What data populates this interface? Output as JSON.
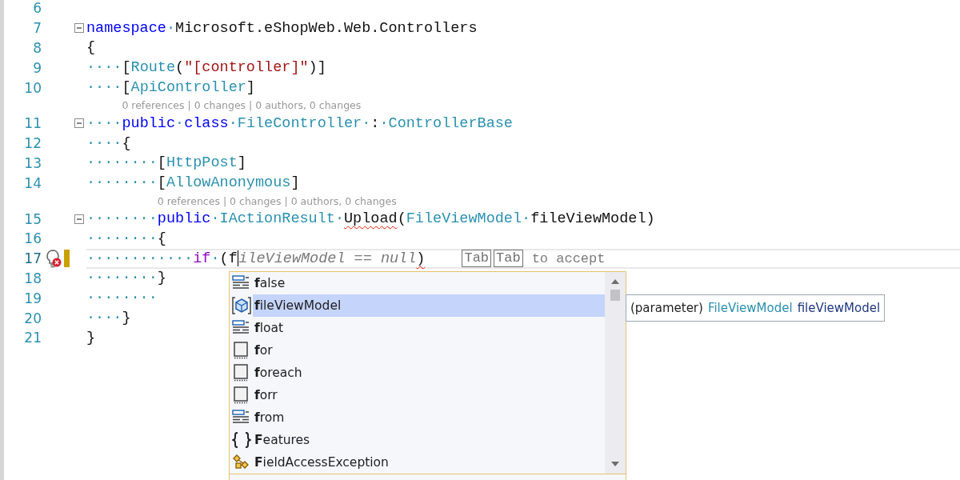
{
  "editor": {
    "lines": [
      {
        "number": "6",
        "fold": false,
        "current": false,
        "changed": false
      },
      {
        "number": "7",
        "fold": true,
        "current": false,
        "changed": false,
        "tokens": [
          {
            "text": "namespace",
            "kind": "keyword"
          },
          {
            "text": "·",
            "kind": "ws"
          },
          {
            "text": "Microsoft.eShopWeb.Web.Controllers",
            "kind": "plain"
          }
        ]
      },
      {
        "number": "8",
        "fold": false,
        "current": false,
        "changed": false,
        "tokens": [
          {
            "text": "{",
            "kind": "plain"
          }
        ]
      },
      {
        "number": "9",
        "fold": false,
        "current": false,
        "changed": false,
        "tokens": [
          {
            "text": "····",
            "kind": "ws"
          },
          {
            "text": "[",
            "kind": "plain"
          },
          {
            "text": "Route",
            "kind": "type"
          },
          {
            "text": "(",
            "kind": "plain"
          },
          {
            "text": "\"[controller]\"",
            "kind": "string"
          },
          {
            "text": ")]",
            "kind": "plain"
          }
        ]
      },
      {
        "number": "10",
        "fold": false,
        "current": false,
        "changed": false,
        "tokens": [
          {
            "text": "····",
            "kind": "ws"
          },
          {
            "text": "[",
            "kind": "plain"
          },
          {
            "text": "ApiController",
            "kind": "type"
          },
          {
            "text": "]",
            "kind": "plain"
          }
        ]
      },
      {
        "number": "11",
        "fold": true,
        "current": false,
        "changed": false,
        "code_lens": "0 references | 0 changes | 0 authors, 0 changes",
        "tokens": [
          {
            "text": "····",
            "kind": "ws"
          },
          {
            "text": "public",
            "kind": "keyword"
          },
          {
            "text": "·",
            "kind": "ws"
          },
          {
            "text": "class",
            "kind": "keyword"
          },
          {
            "text": "·",
            "kind": "ws"
          },
          {
            "text": "FileController",
            "kind": "type"
          },
          {
            "text": "·",
            "kind": "ws"
          },
          {
            "text": ":",
            "kind": "plain"
          },
          {
            "text": "·",
            "kind": "ws"
          },
          {
            "text": "ControllerBase",
            "kind": "type"
          }
        ]
      },
      {
        "number": "12",
        "fold": false,
        "current": false,
        "changed": false,
        "tokens": [
          {
            "text": "····",
            "kind": "ws"
          },
          {
            "text": "{",
            "kind": "plain"
          }
        ]
      },
      {
        "number": "13",
        "fold": false,
        "current": false,
        "changed": false,
        "tokens": [
          {
            "text": "········",
            "kind": "ws"
          },
          {
            "text": "[",
            "kind": "plain"
          },
          {
            "text": "HttpPost",
            "kind": "type"
          },
          {
            "text": "]",
            "kind": "plain"
          }
        ]
      },
      {
        "number": "14",
        "fold": false,
        "current": false,
        "changed": false,
        "tokens": [
          {
            "text": "········",
            "kind": "ws"
          },
          {
            "text": "[",
            "kind": "plain"
          },
          {
            "text": "AllowAnonymous",
            "kind": "type"
          },
          {
            "text": "]",
            "kind": "plain"
          }
        ]
      },
      {
        "number": "15",
        "fold": true,
        "current": false,
        "changed": false,
        "code_lens": "0 references | 0 changes | 0 authors, 0 changes",
        "tokens": [
          {
            "text": "········",
            "kind": "ws"
          },
          {
            "text": "public",
            "kind": "keyword"
          },
          {
            "text": "·",
            "kind": "ws"
          },
          {
            "text": "IActionResult",
            "kind": "type"
          },
          {
            "text": "·",
            "kind": "ws"
          },
          {
            "text": "Upload",
            "kind": "error"
          },
          {
            "text": "(",
            "kind": "plain"
          },
          {
            "text": "FileViewModel",
            "kind": "type"
          },
          {
            "text": "·",
            "kind": "ws"
          },
          {
            "text": "fileViewModel",
            "kind": "plain"
          },
          {
            "text": ")",
            "kind": "plain"
          }
        ]
      },
      {
        "number": "16",
        "fold": false,
        "current": false,
        "changed": false,
        "tokens": [
          {
            "text": "········",
            "kind": "ws"
          },
          {
            "text": "{",
            "kind": "plain"
          }
        ]
      },
      {
        "number": "17",
        "fold": false,
        "current": true,
        "changed": true,
        "lightbulb_error": true,
        "tokens": [
          {
            "text": "············",
            "kind": "ws"
          },
          {
            "text": "if",
            "kind": "control"
          },
          {
            "text": "·",
            "kind": "ws"
          },
          {
            "text": "(",
            "kind": "plain"
          },
          {
            "text": "f",
            "kind": "typed"
          },
          {
            "text": "ileViewModel == null",
            "kind": "ghost"
          },
          {
            "text": ")",
            "kind": "error"
          }
        ],
        "inline_hint": {
          "keys": [
            "Tab",
            "Tab"
          ],
          "text": "to accept"
        }
      },
      {
        "number": "18",
        "fold": false,
        "current": false,
        "changed": false,
        "tokens": [
          {
            "text": "········",
            "kind": "ws"
          },
          {
            "text": "}",
            "kind": "plain"
          }
        ]
      },
      {
        "number": "19",
        "fold": false,
        "current": false,
        "changed": false,
        "tokens": [
          {
            "text": "········",
            "kind": "ws"
          }
        ]
      },
      {
        "number": "20",
        "fold": false,
        "current": false,
        "changed": false,
        "tokens": [
          {
            "text": "····",
            "kind": "ws"
          },
          {
            "text": "}",
            "kind": "plain"
          }
        ]
      },
      {
        "number": "21",
        "fold": false,
        "current": false,
        "changed": false,
        "tokens": [
          {
            "text": "}",
            "kind": "plain"
          }
        ]
      }
    ]
  },
  "completion_list": {
    "items": [
      {
        "label": "**f**alse",
        "kind": "keyword",
        "selected": false
      },
      {
        "label": "**f**ileViewModel",
        "kind": "parameter",
        "selected": true
      },
      {
        "label": "**f**loat",
        "kind": "keyword",
        "selected": false
      },
      {
        "label": "**f**or",
        "kind": "snippet",
        "selected": false
      },
      {
        "label": "**f**oreach",
        "kind": "snippet",
        "selected": false
      },
      {
        "label": "**f**orr",
        "kind": "snippet",
        "selected": false
      },
      {
        "label": "**f**rom",
        "kind": "keyword",
        "selected": false
      },
      {
        "label": "**F**eatures",
        "kind": "namespace",
        "selected": false
      },
      {
        "label": "**F**ieldAccessException",
        "kind": "class",
        "selected": false
      }
    ]
  },
  "quick_info": {
    "prefix": "(parameter)",
    "type": "FileViewModel",
    "name": "fileViewModel"
  }
}
